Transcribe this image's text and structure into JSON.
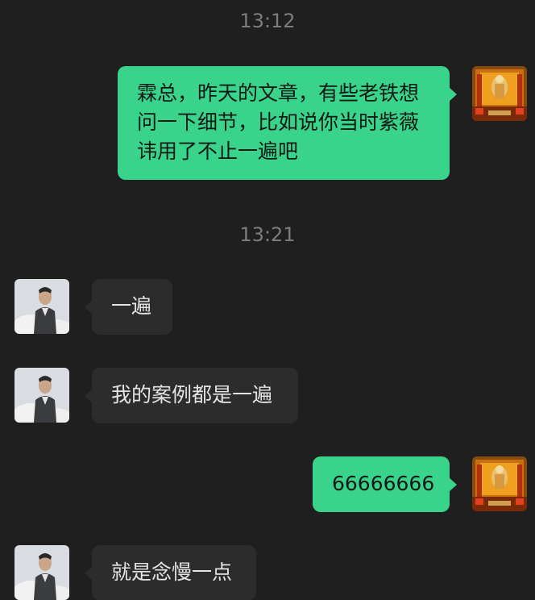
{
  "timestamps": [
    "13:12",
    "13:21"
  ],
  "messages": [
    {
      "sender": "self",
      "text": "霖总，昨天的文章，有些老铁想\n问一下细节，比如说你当时紫薇\n讳用了不止一遍吧"
    },
    {
      "sender": "contact",
      "text": "一遍"
    },
    {
      "sender": "contact",
      "text": "我的案例都是一遍"
    },
    {
      "sender": "self",
      "text": "66666666"
    },
    {
      "sender": "contact",
      "text": "就是念慢一点"
    }
  ],
  "colors": {
    "background": "#1f1f1f",
    "self_bubble": "#3ad38c",
    "contact_bubble": "#2c2c2c",
    "timestamp_text": "#7d7d7d"
  },
  "avatars": {
    "self": "temple-altar-avatar",
    "contact": "man-portrait-avatar"
  }
}
